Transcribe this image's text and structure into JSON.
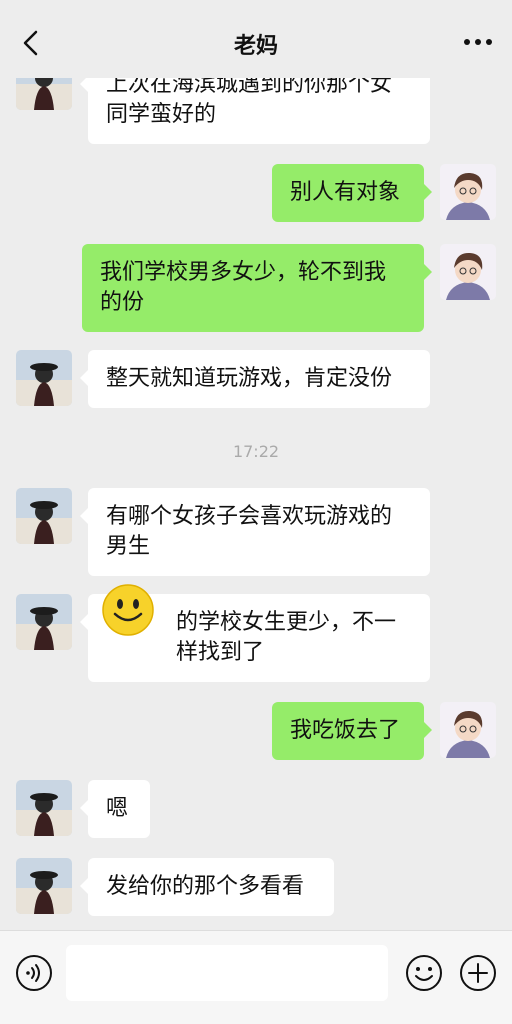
{
  "header": {
    "title": "老妈"
  },
  "messages": [
    {
      "side": "left",
      "text": "上次在海滨城遇到的你那个女同学蛮好的"
    },
    {
      "side": "right",
      "text": "别人有对象"
    },
    {
      "side": "right",
      "text": "我们学校男多女少，轮不到我的份"
    },
    {
      "side": "left",
      "text": "整天就知道玩游戏，肯定没份"
    },
    {
      "side": "left",
      "text": "有哪个女孩子会喜欢玩游戏的男生"
    },
    {
      "side": "left",
      "text": "的学校女生更少，不一样找到了"
    },
    {
      "side": "right",
      "text": "我吃饭去了"
    },
    {
      "side": "left",
      "text": "嗯"
    },
    {
      "side": "left",
      "text": "发给你的那个多看看"
    }
  ],
  "timestamp": "17:22",
  "input": {
    "placeholder": ""
  },
  "colors": {
    "background": "#ededed",
    "bubble_self": "#95ec69",
    "bubble_other": "#ffffff"
  },
  "icons": {
    "back": "chevron-left-icon",
    "more": "more-dots-icon",
    "voice": "voice-icon",
    "emoji": "emoji-icon",
    "plus": "plus-icon"
  }
}
